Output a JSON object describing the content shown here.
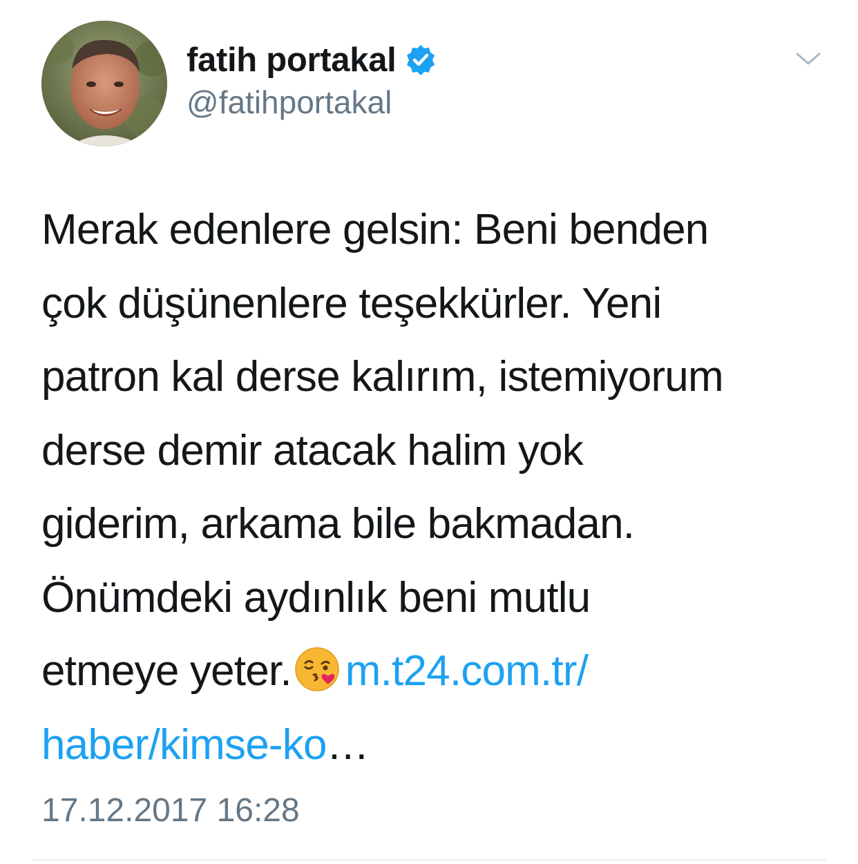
{
  "tweet": {
    "author": {
      "display_name": "fatih portakal",
      "handle": "@fatihportakal",
      "verified": true,
      "avatar_icon": "profile-photo"
    },
    "text_lines": [
      "Merak edenlere gelsin: Beni benden",
      "çok düşünenlere teşekkürler. Yeni",
      "patron kal derse kalırım, istemiyorum",
      "derse demir atacak halim yok",
      "giderim, arkama bile bakmadan.",
      "Önümdeki aydınlık beni mutlu"
    ],
    "last_line_text": "etmeye yeter.",
    "emoji": "face-throwing-a-kiss",
    "link_part1": "m.t24.com.tr/",
    "link_part2": "haber/kimse-ko",
    "link_ellipsis": "…",
    "timestamp": "17.12.2017 16:28",
    "menu_icon": "chevron-down-icon"
  },
  "colors": {
    "text": "#14171a",
    "secondary": "#657786",
    "link": "#1da1f2",
    "verified": "#1da1f2",
    "divider": "#e6ecf0"
  }
}
